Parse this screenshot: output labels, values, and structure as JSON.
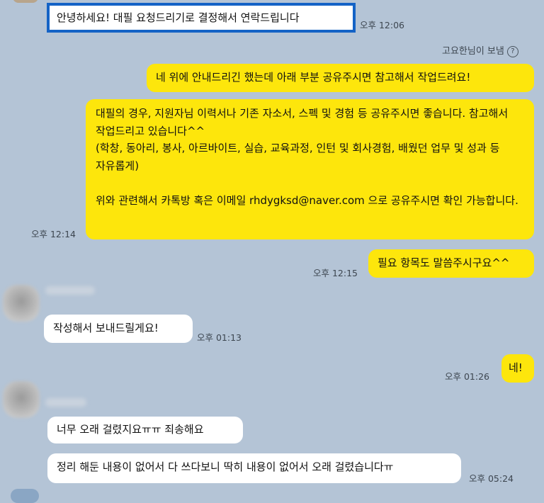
{
  "messages": [
    {
      "text": "안녕하세요! 대필 요청드리기로 결정해서 연락드립니다",
      "time": "오후 12:06"
    },
    {
      "text": "네 위에 안내드리긴 했는데 아래 부분 공유주시면 참고해서 작업드려요!"
    },
    {
      "text": "대필의 경우, 지원자님 이력서나 기존 자소서, 스펙 및 경험 등 공유주시면 좋습니다. 참고해서 작업드리고 있습니다^^\n(학창, 동아리, 봉사, 아르바이트, 실습, 교육과정, 인턴 및 회사경험, 배웠던 업무 및 성과 등 자유롭게)\n\n위와 관련해서 카톡방 혹은 이메일 rhdygksd@naver.com 으로 공유주시면 확인 가능합니다.",
      "time": "오후 12:14"
    },
    {
      "text": "필요 항목도 말씀주시구요^^",
      "time": "오후 12:15"
    },
    {
      "text": "작성해서 보내드릴게요!",
      "time": "오후 01:13"
    },
    {
      "text": "네!",
      "time": "오후 01:26"
    },
    {
      "text": "너무 오래 걸렸지요ㅠㅠ 죄송해요"
    },
    {
      "text": "정리 해둔 내용이 없어서 다 쓰다보니 딱히 내용이 없어서 오래 걸렸습니다ㅠ",
      "time": "오후 05:24"
    }
  ],
  "sender_note": {
    "text": "고요한님이 보냄",
    "icon": "?"
  }
}
